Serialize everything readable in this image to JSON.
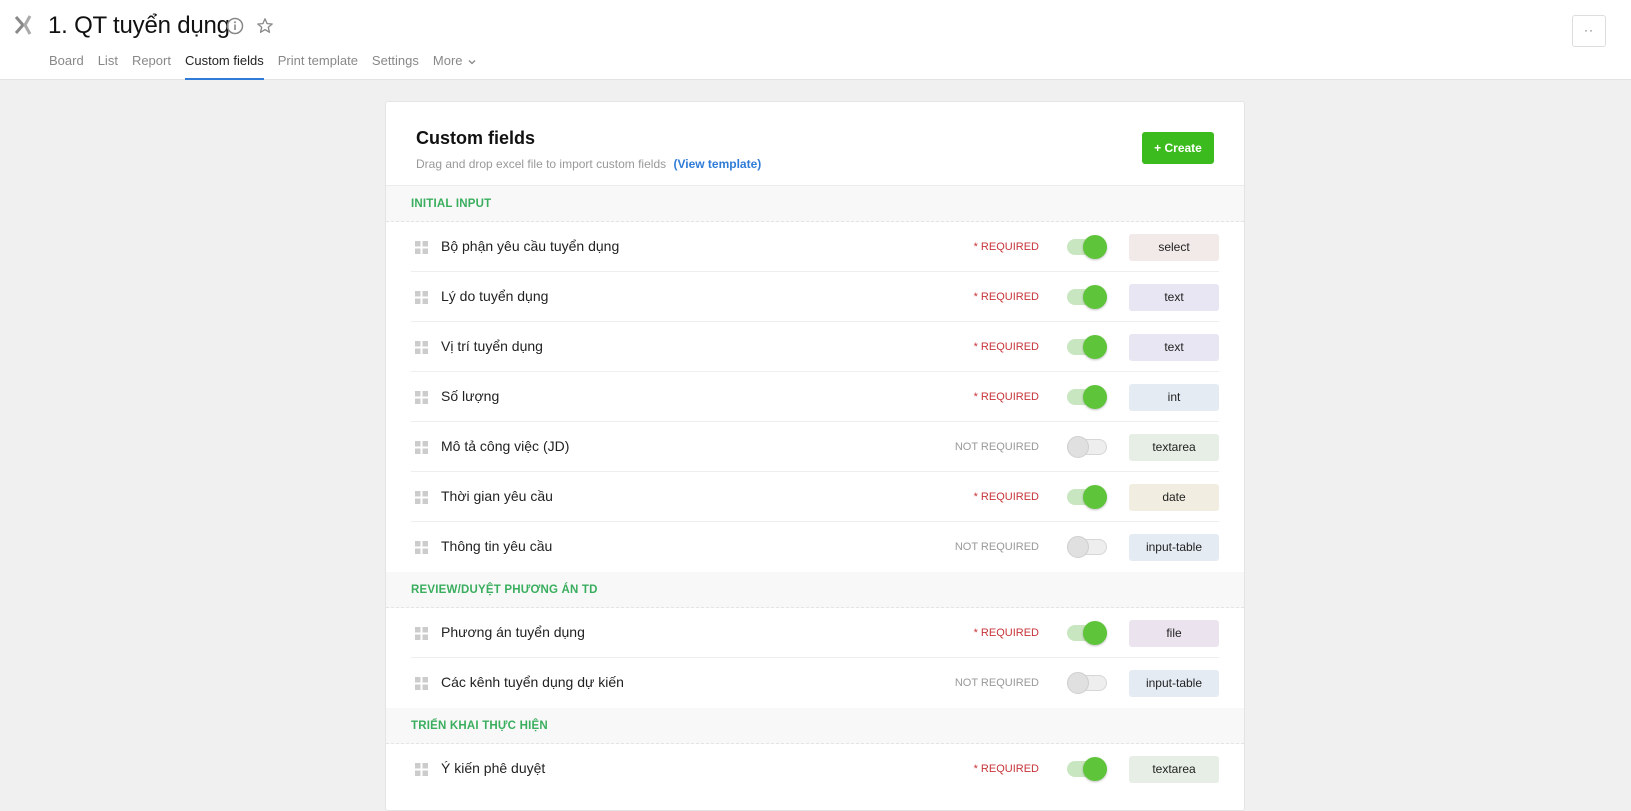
{
  "header": {
    "title": "1. QT tuyển dụng",
    "more_button": "··",
    "tabs": [
      {
        "label": "Board"
      },
      {
        "label": "List"
      },
      {
        "label": "Report"
      },
      {
        "label": "Custom fields"
      },
      {
        "label": "Print template"
      },
      {
        "label": "Settings"
      },
      {
        "label": "More"
      }
    ],
    "active_tab": "Custom fields"
  },
  "card": {
    "title": "Custom fields",
    "subtitle": "Drag and drop excel file to import custom fields",
    "template_link": "(View template)",
    "create_label": "+ Create"
  },
  "colors": {
    "accent_green": "#3cbb1e",
    "section_green": "#3aae5e",
    "required_red": "#c7343a",
    "link_blue": "#2f7cd8"
  },
  "sections": [
    {
      "name": "INITIAL INPUT",
      "fields": [
        {
          "label": "Bộ phận yêu cầu tuyển dụng",
          "required_text": "* REQUIRED",
          "required": true,
          "type": "select"
        },
        {
          "label": "Lý do tuyển dụng",
          "required_text": "* REQUIRED",
          "required": true,
          "type": "text"
        },
        {
          "label": "Vị trí tuyển dụng",
          "required_text": "* REQUIRED",
          "required": true,
          "type": "text"
        },
        {
          "label": "Số lượng",
          "required_text": "* REQUIRED",
          "required": true,
          "type": "int"
        },
        {
          "label": "Mô tả công việc (JD)",
          "required_text": "NOT REQUIRED",
          "required": false,
          "type": "textarea"
        },
        {
          "label": "Thời gian yêu cầu",
          "required_text": "* REQUIRED",
          "required": true,
          "type": "date"
        },
        {
          "label": "Thông tin yêu cầu",
          "required_text": "NOT REQUIRED",
          "required": false,
          "type": "input-table"
        }
      ]
    },
    {
      "name": "REVIEW/DUYỆT PHƯƠNG ÁN TD",
      "fields": [
        {
          "label": "Phương án tuyển dụng",
          "required_text": "* REQUIRED",
          "required": true,
          "type": "file"
        },
        {
          "label": "Các kênh tuyển dụng dự kiến",
          "required_text": "NOT REQUIRED",
          "required": false,
          "type": "input-table"
        }
      ]
    },
    {
      "name": "TRIỂN KHAI THỰC HIỆN",
      "fields": [
        {
          "label": "Ý kiến phê duyệt",
          "required_text": "* REQUIRED",
          "required": true,
          "type": "textarea"
        }
      ]
    }
  ]
}
